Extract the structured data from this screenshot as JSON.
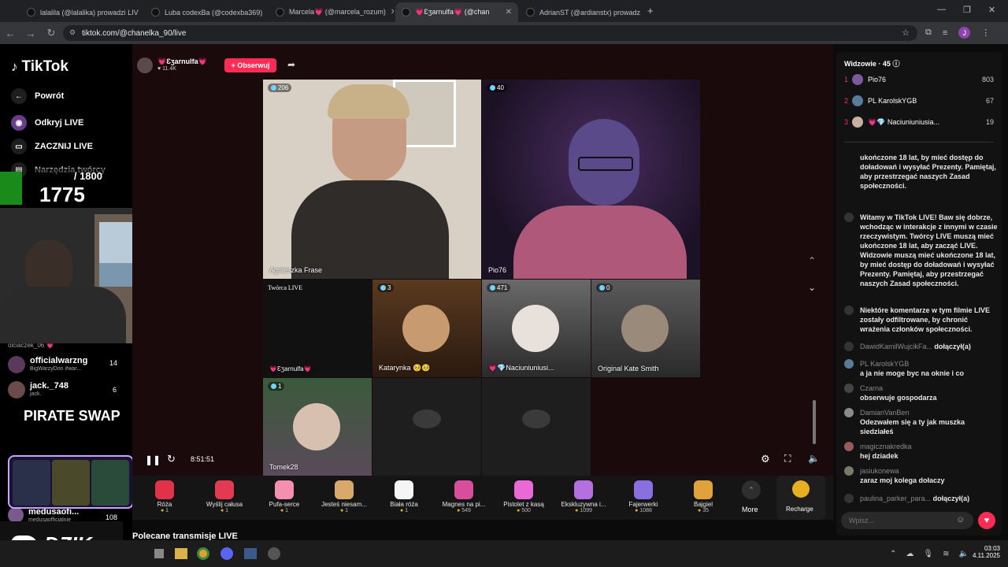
{
  "browser": {
    "tabs": [
      {
        "label": "lalalila (@lalalika) prowadzi LIV"
      },
      {
        "label": "Luba codexBa (@codexba369)"
      },
      {
        "label": "Marcela💗 (@marcela_rozum)"
      },
      {
        "label": "💗Ɛʒarnulfa💗 (@chan"
      },
      {
        "label": "AdrianST (@ardianstx) prowadz"
      }
    ],
    "url": "tiktok.com/@chanelka_90/live",
    "profile_initial": "J"
  },
  "nav": {
    "logo": "TikTok",
    "back": "Powrót",
    "discover": "Odkryj LIVE",
    "start": "ZACZNIJ LIVE",
    "tools": "Narzędzia twórcy"
  },
  "overlay": {
    "counter_total": "/ 1800",
    "counter_value": "1775",
    "sponsor": "PIRATE SWAP",
    "streamer_logo": "DZIK."
  },
  "leftlist": [
    {
      "name": "olciaczek_06 💗",
      "sub": "",
      "count": ""
    },
    {
      "name": "officialwarzng",
      "sub": "BigWarzyDon #war...",
      "count": "14"
    },
    {
      "name": "jack._748",
      "sub": "jack.",
      "count": "6"
    },
    {
      "name": "medusaofi...",
      "sub": "medusaofficialnie",
      "count": "108"
    }
  ],
  "stream": {
    "host_name": "💗Ɛʒarnulfa💗",
    "likes": "11.4K",
    "follow": "+ Obserwuj",
    "time": "8:51:51"
  },
  "cells": [
    {
      "name": "Agnieszka Frase",
      "count": "206"
    },
    {
      "name": "Pio76",
      "count": "40"
    },
    {
      "name": "Twórca LIVE",
      "count": "",
      "footer": "💗Ɛʒarnulfa💗"
    },
    {
      "name": "Katarynka 🥺🥺",
      "count": "3"
    },
    {
      "name": "💗💎Naciuniuniusi...",
      "count": "471"
    },
    {
      "name": "Original Kate Smith",
      "count": "0"
    },
    {
      "name": "Tomek28",
      "count": "1"
    }
  ],
  "gifts": [
    {
      "name": "Róża",
      "price": "1",
      "color": "#e0334a"
    },
    {
      "name": "Wyślij całusa",
      "price": "1",
      "color": "#e23a52"
    },
    {
      "name": "Pufa-serce",
      "price": "1",
      "color": "#f58fb0"
    },
    {
      "name": "Jesteś niesam...",
      "price": "1",
      "color": "#d9a96a"
    },
    {
      "name": "Biała róża",
      "price": "1",
      "color": "#f5f5f5"
    },
    {
      "name": "Magnes na pi...",
      "price": "549",
      "color": "#d64e9c"
    },
    {
      "name": "Pistolet z kasą",
      "price": "500",
      "color": "#e96ad6"
    },
    {
      "name": "Ekskluzywna i...",
      "price": "1099",
      "color": "#b66fe0"
    },
    {
      "name": "Fajerwerki",
      "price": "1088",
      "color": "#8a6fe0"
    },
    {
      "name": "Bajgiel",
      "price": "35",
      "color": "#e0a23a"
    }
  ],
  "gift_more": "More",
  "recharge": "Recharge",
  "section_title": "Polecane transmisje LIVE",
  "chat": {
    "viewers_label": "Widzowie · 45",
    "top": [
      {
        "rank": "1",
        "name": "Pio76",
        "score": "803"
      },
      {
        "rank": "2",
        "name": "PL KarolskYGB",
        "score": "67"
      },
      {
        "rank": "3",
        "name": "💗💎 Naciuniuniusia...",
        "score": "19"
      }
    ],
    "msg0": "ukończone 18 lat, by mieć dostęp do doładowań i wysyłać Prezenty. Pamiętaj, aby przestrzegać naszych Zasad społeczności.",
    "msg1": "Witamy w TikTok LIVE! Baw się dobrze, wchodząc w interakcje z innymi w czasie rzeczywistym. Twórcy LIVE muszą mieć ukończone 18 lat, aby zacząć LIVE. Widzowie muszą mieć ukończone 18 lat, by mieć dostęp do doładowań i wysyłać Prezenty. Pamiętaj, aby przestrzegać naszych Zasad społeczności.",
    "msg2": "Niektóre komentarze w tym filmie LIVE zostały odfiltrowane, by chronić wrażenia członków społeczności.",
    "join1_user": "DawidKamilWujcikFa...",
    "join_label": "dołączył(a)",
    "c1_user": "PL KarolskYGB",
    "c1_text": "a ja nie moge byc na oknie i co",
    "c2_user": "Czarna",
    "c2_text": "obserwuje gospodarza",
    "c3_user": "DamianVanBen",
    "c3_text": "Odezwałem się a ty jak muszka siedziałeś",
    "c4_user": "magicznakredka",
    "c4_text": "hej dziadek",
    "c5_user": "jasiukonewa",
    "c5_text": "zaraz moj kolega dołaczy",
    "join2_user": "paulina_parker_para...",
    "input_placeholder": "Wpisz..."
  },
  "taskbar": {
    "time": "03:03",
    "date": "4.11.2025"
  }
}
